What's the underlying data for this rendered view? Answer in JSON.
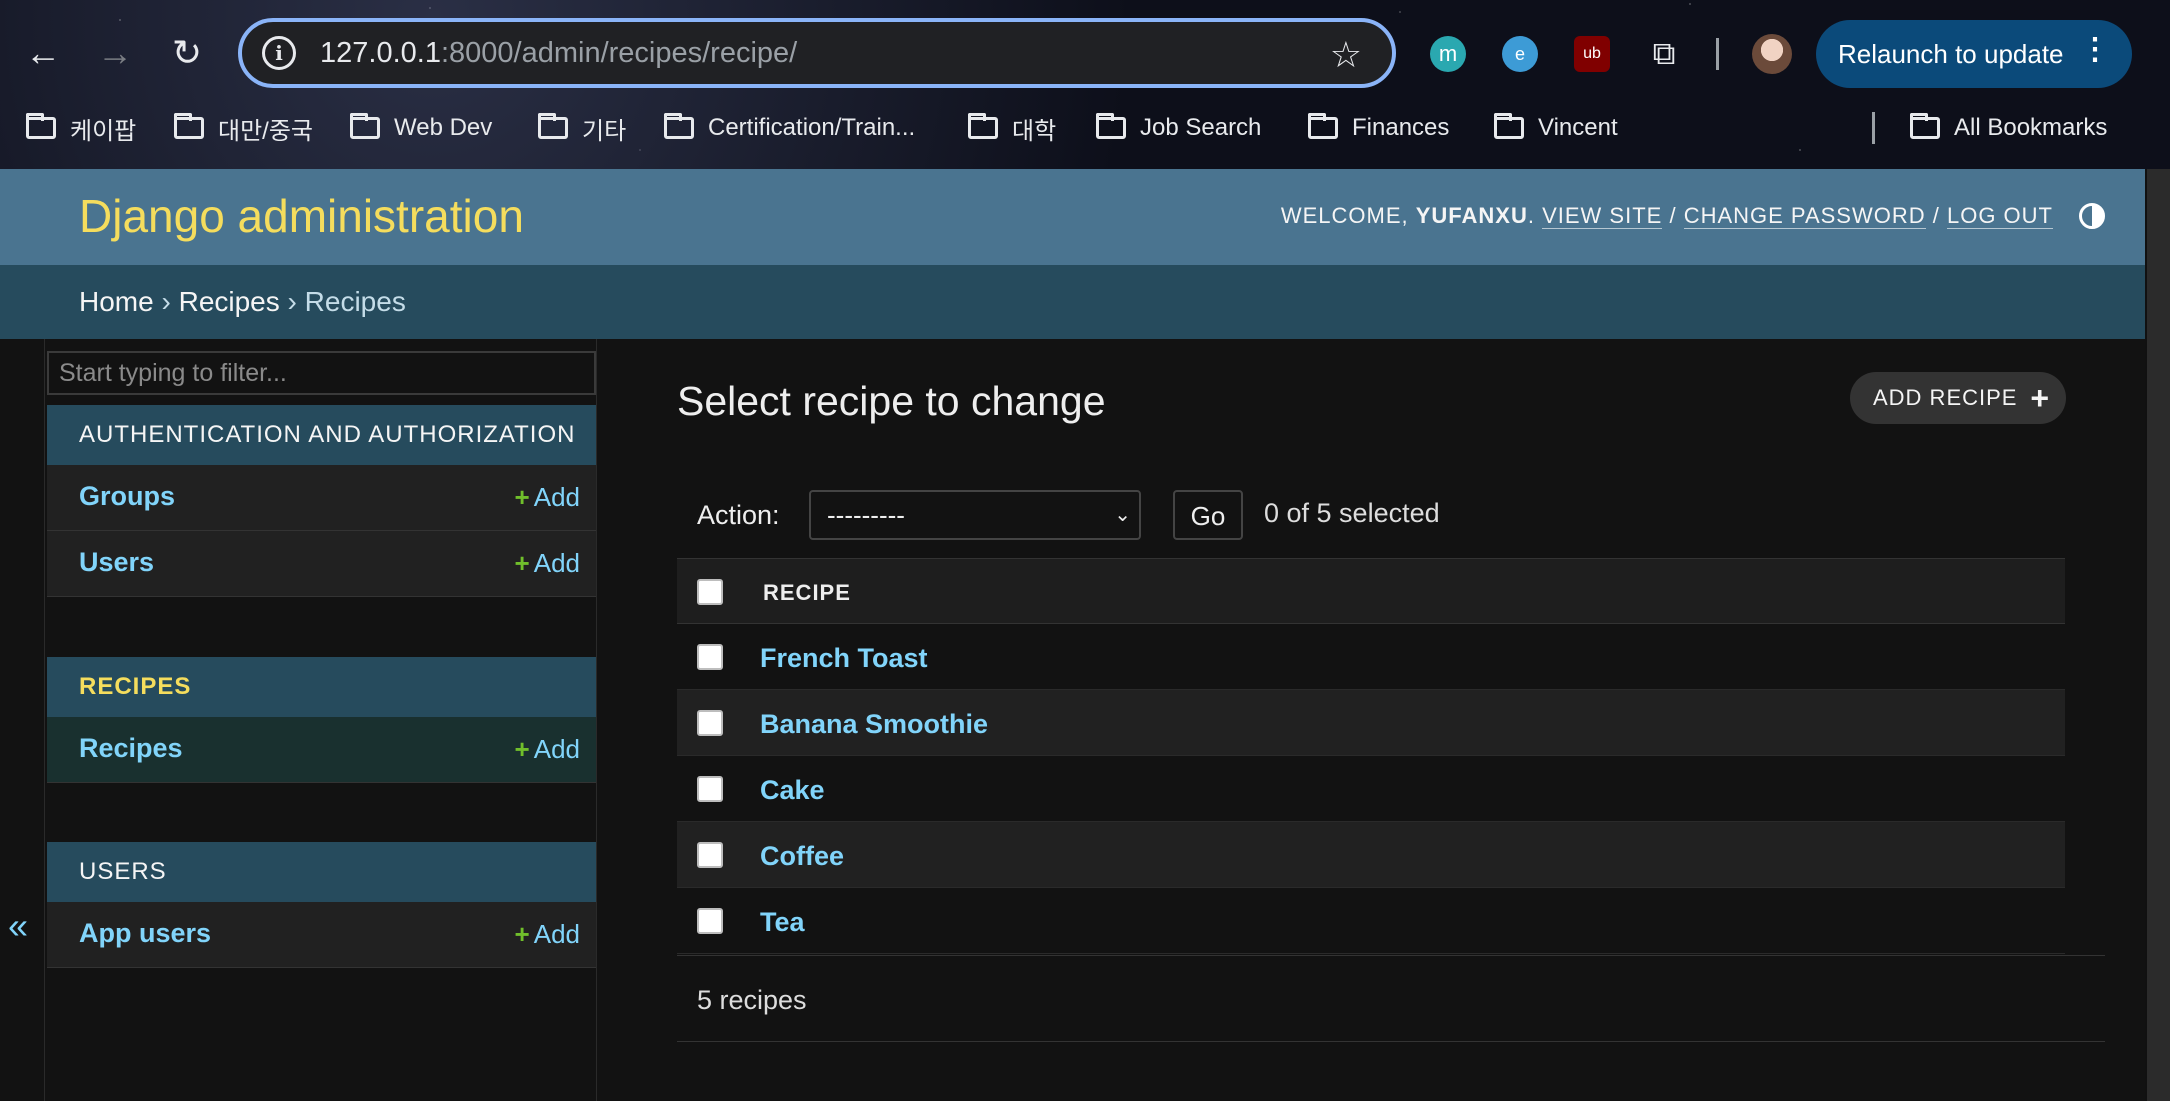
{
  "browser": {
    "url_host": "127.0.0.1",
    "url_rest": ":8000/admin/recipes/recipe/",
    "relaunch_label": "Relaunch to update",
    "bookmarks": [
      "케이팝",
      "대만/중국",
      "Web Dev",
      "기타",
      "Certification/Train...",
      "대학",
      "Job Search",
      "Finances",
      "Vincent"
    ],
    "all_bookmarks": "All Bookmarks",
    "extensions": [
      "m",
      "e",
      "ub"
    ]
  },
  "header": {
    "site_title": "Django administration",
    "welcome": "WELCOME,",
    "username": "YUFANXU",
    "view_site": "VIEW SITE",
    "change_password": "CHANGE PASSWORD",
    "log_out": "LOG OUT"
  },
  "breadcrumbs": [
    "Home",
    "Recipes",
    "Recipes"
  ],
  "sidebar": {
    "filter_placeholder": "Start typing to filter...",
    "modules": [
      {
        "caption": "AUTHENTICATION AND AUTHORIZATION",
        "items": [
          {
            "name": "Groups",
            "add": "Add"
          },
          {
            "name": "Users",
            "add": "Add"
          }
        ]
      },
      {
        "caption": "RECIPES",
        "items": [
          {
            "name": "Recipes",
            "add": "Add"
          }
        ]
      },
      {
        "caption": "USERS",
        "items": [
          {
            "name": "App users",
            "add": "Add"
          }
        ]
      }
    ],
    "collapse": "«"
  },
  "content": {
    "title": "Select recipe to change",
    "add_button": "ADD RECIPE",
    "action_label": "Action:",
    "action_selected": "---------",
    "go": "Go",
    "counter": "0 of 5 selected",
    "column": "RECIPE",
    "rows": [
      "French Toast",
      "Banana Smoothie",
      "Cake",
      "Coffee",
      "Tea"
    ],
    "paginator": "5 recipes"
  },
  "colors": {
    "accent": "#f5dd5d",
    "header_bg": "#4a7490",
    "link": "#81d4fa",
    "add_plus": "#70bf2b"
  }
}
